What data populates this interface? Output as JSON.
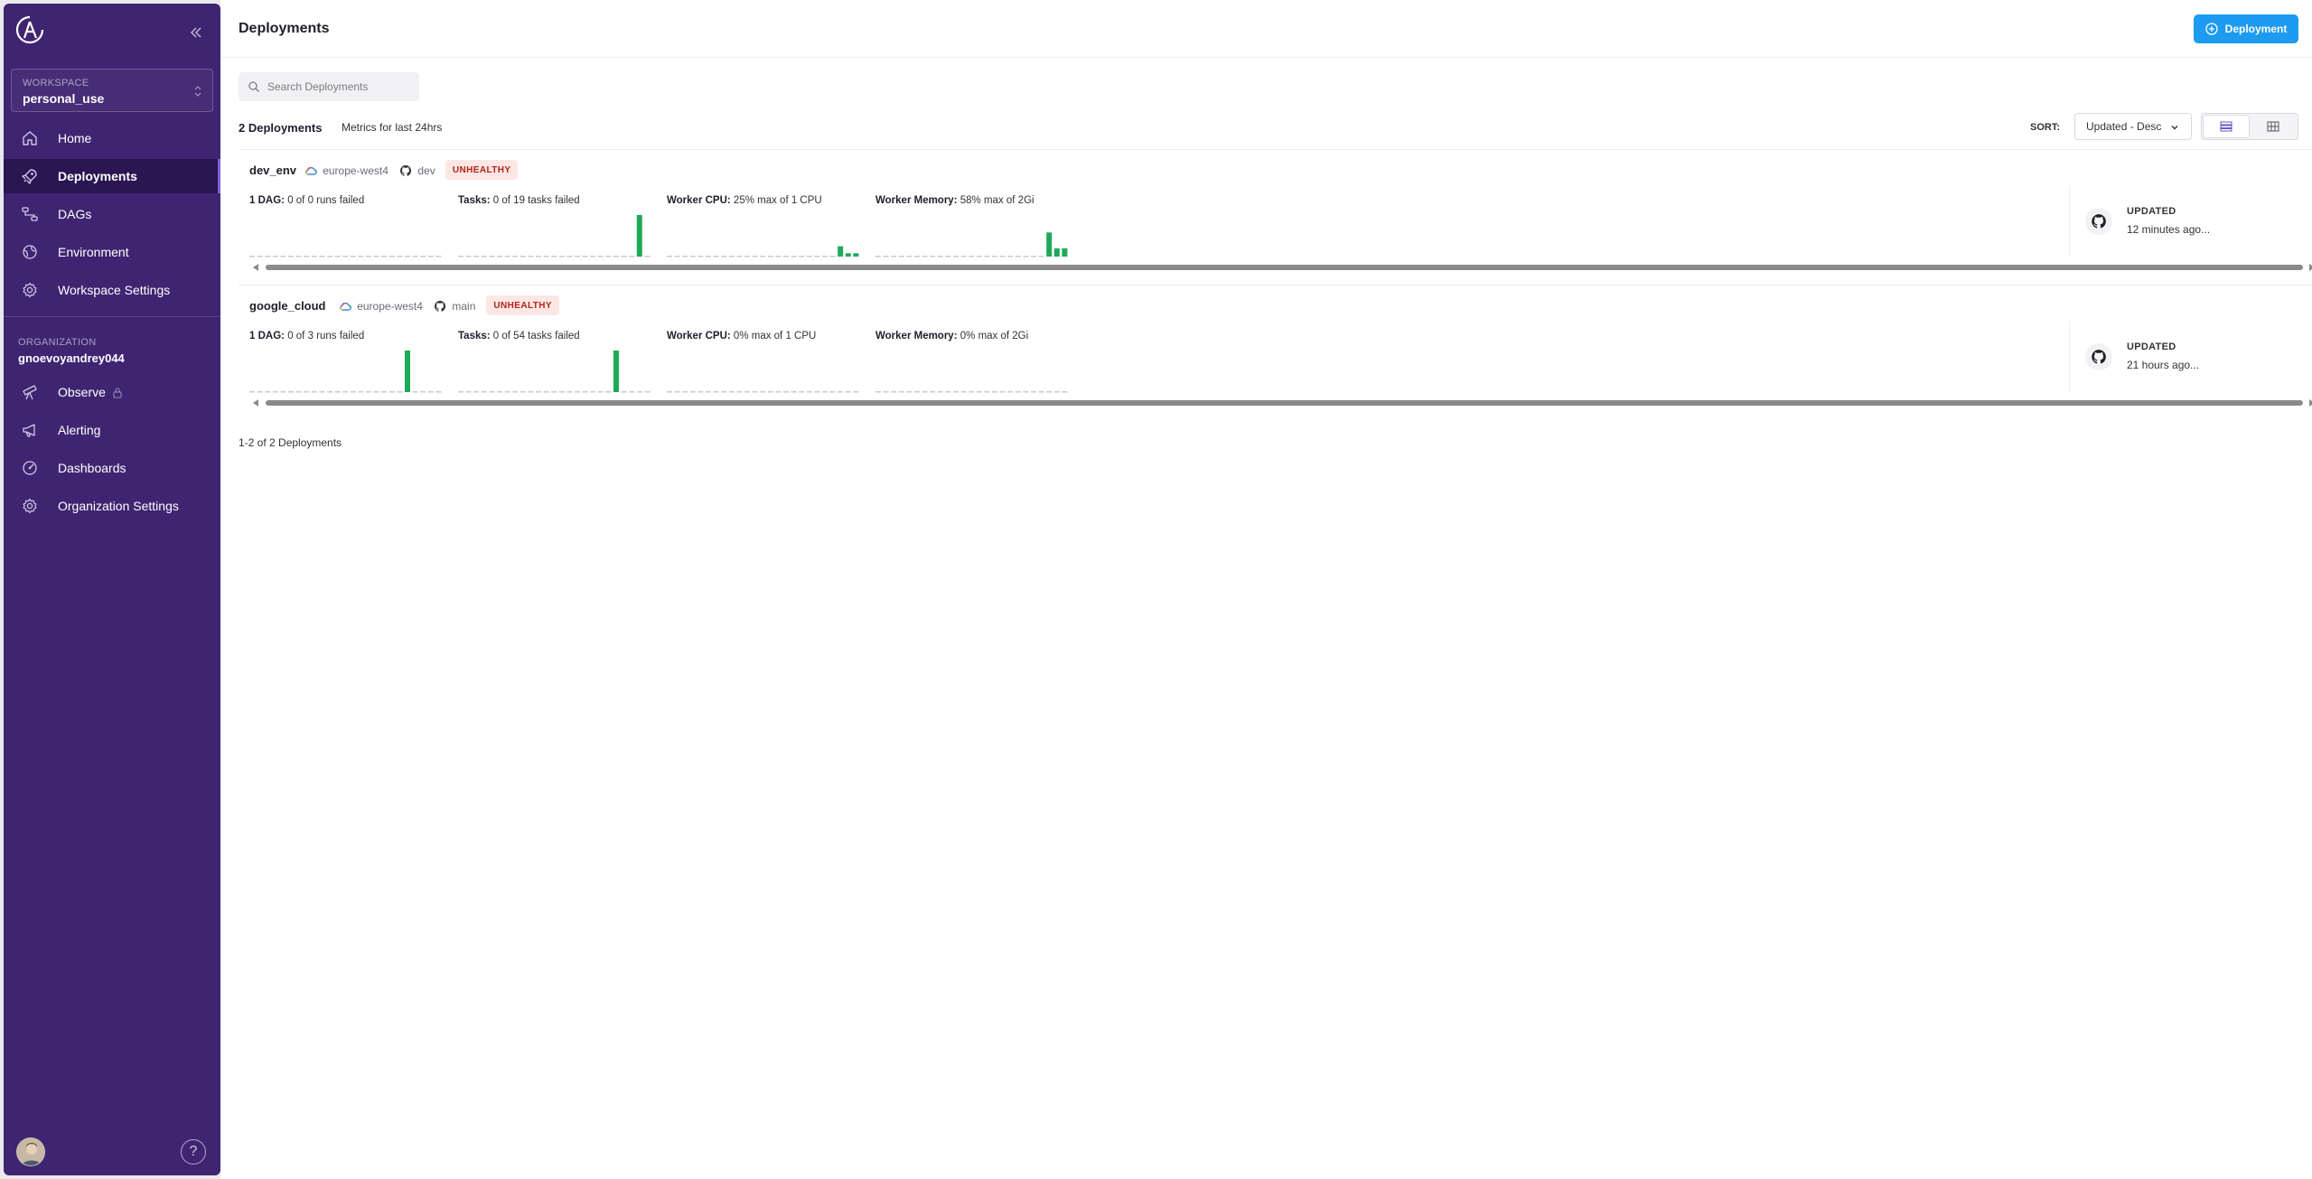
{
  "sidebar": {
    "workspace_label": "WORKSPACE",
    "workspace_name": "personal_use",
    "nav": [
      {
        "label": "Home",
        "icon": "home-icon"
      },
      {
        "label": "Deployments",
        "icon": "rocket-icon"
      },
      {
        "label": "DAGs",
        "icon": "dag-icon"
      },
      {
        "label": "Environment",
        "icon": "globe-icon"
      },
      {
        "label": "Workspace Settings",
        "icon": "gear-icon"
      }
    ],
    "org_label": "ORGANIZATION",
    "org_name": "gnoevoyandrey044",
    "org_nav": [
      {
        "label": "Observe",
        "icon": "telescope-icon"
      },
      {
        "label": "Alerting",
        "icon": "megaphone-icon"
      },
      {
        "label": "Dashboards",
        "icon": "dashboard-icon"
      },
      {
        "label": "Organization Settings",
        "icon": "gear-icon"
      }
    ],
    "help": "?"
  },
  "header": {
    "title": "Deployments",
    "add_button": "Deployment"
  },
  "toolbar": {
    "search_placeholder": "Search Deployments",
    "count": "2 Deployments",
    "metrics_note": "Metrics for last 24hrs",
    "sort_label": "SORT:",
    "sort_value": "Updated - Desc"
  },
  "deployments": [
    {
      "name": "dev_env",
      "region": "europe-west4",
      "branch": "dev",
      "status": "UNHEALTHY",
      "dag_label": "1 DAG:",
      "dag_text": "0 of 0 runs failed",
      "tasks_label": "Tasks:",
      "tasks_text": "0 of 19 tasks failed",
      "cpu_label": "Worker CPU:",
      "cpu_text": "25% max of 1 CPU",
      "mem_label": "Worker Memory:",
      "mem_text": "58% max of 2Gi",
      "updated_label": "UPDATED",
      "updated_time": "12 minutes ago...",
      "spark_dag": [],
      "spark_tasks": [
        {
          "i": 23,
          "v": 1.0
        }
      ],
      "spark_cpu": [
        {
          "i": 22,
          "v": 0.25
        },
        {
          "i": 23,
          "v": 0.08
        },
        {
          "i": 24,
          "v": 0.08
        }
      ],
      "spark_mem": [
        {
          "i": 22,
          "v": 0.58
        },
        {
          "i": 23,
          "v": 0.2
        },
        {
          "i": 24,
          "v": 0.2
        }
      ]
    },
    {
      "name": "google_cloud",
      "region": "europe-west4",
      "branch": "main",
      "status": "UNHEALTHY",
      "dag_label": "1 DAG:",
      "dag_text": "0 of 3 runs failed",
      "tasks_label": "Tasks:",
      "tasks_text": "0 of 54 tasks failed",
      "cpu_label": "Worker CPU:",
      "cpu_text": "0% max of 1 CPU",
      "mem_label": "Worker Memory:",
      "mem_text": "0% max of 2Gi",
      "updated_label": "UPDATED",
      "updated_time": "21 hours ago...",
      "spark_dag": [
        {
          "i": 20,
          "v": 1.0
        }
      ],
      "spark_tasks": [
        {
          "i": 20,
          "v": 1.0
        }
      ],
      "spark_cpu": [],
      "spark_mem": []
    }
  ],
  "paging": "1-2 of 2 Deployments",
  "colors": {
    "sidebar": "#3f2571",
    "accent": "#1d9bf0",
    "bar": "#1faa59",
    "danger": "#b42318"
  }
}
